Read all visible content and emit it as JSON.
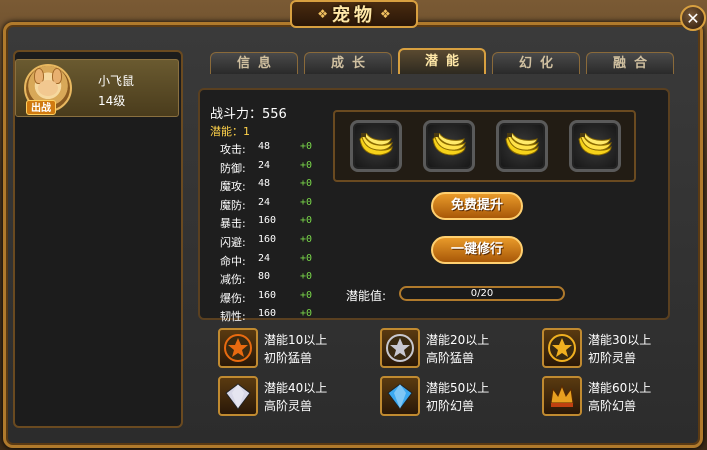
{
  "window": {
    "title": "宠物"
  },
  "pet": {
    "name": "小飞鼠",
    "level": "14级",
    "battle_tag": "出战"
  },
  "tabs": [
    {
      "label": "信息",
      "active": false
    },
    {
      "label": "成长",
      "active": false
    },
    {
      "label": "潜能",
      "active": true
    },
    {
      "label": "幻化",
      "active": false
    },
    {
      "label": "融合",
      "active": false
    }
  ],
  "stats": {
    "combat_power": "战斗力：556",
    "potential": "潜能：1",
    "rows": [
      {
        "name": "攻击:",
        "value": "48",
        "bonus": "+0"
      },
      {
        "name": "防御:",
        "value": "24",
        "bonus": "+0"
      },
      {
        "name": "魔攻:",
        "value": "48",
        "bonus": "+0"
      },
      {
        "name": "魔防:",
        "value": "24",
        "bonus": "+0"
      },
      {
        "name": "暴击:",
        "value": "160",
        "bonus": "+0"
      },
      {
        "name": "闪避:",
        "value": "160",
        "bonus": "+0"
      },
      {
        "name": "命中:",
        "value": "24",
        "bonus": "+0"
      },
      {
        "name": "减伤:",
        "value": "80",
        "bonus": "+0"
      },
      {
        "name": "爆伤:",
        "value": "160",
        "bonus": "+0"
      },
      {
        "name": "韧性:",
        "value": "160",
        "bonus": "+0"
      }
    ]
  },
  "slots": [
    {
      "icon": "banana-icon"
    },
    {
      "icon": "banana-icon"
    },
    {
      "icon": "banana-icon"
    },
    {
      "icon": "banana-icon"
    }
  ],
  "buttons": {
    "free_upgrade": "免费提升",
    "one_click_train": "一键修行"
  },
  "potential_bar": {
    "label": "潜能值:",
    "text": "0/20",
    "fraction": 0
  },
  "rewards": [
    {
      "line1": "潜能10以上",
      "line2": "初阶猛兽",
      "icon": "orange-star-badge-icon",
      "color": "#e86a10"
    },
    {
      "line1": "潜能20以上",
      "line2": "高阶猛兽",
      "icon": "silver-star-badge-icon",
      "color": "#c8c8d0"
    },
    {
      "line1": "潜能30以上",
      "line2": "初阶灵兽",
      "icon": "gold-star-badge-icon",
      "color": "#f0b020"
    },
    {
      "line1": "潜能40以上",
      "line2": "高阶灵兽",
      "icon": "silver-diamond-badge-icon",
      "color": "#d8d8e8"
    },
    {
      "line1": "潜能50以上",
      "line2": "初阶幻兽",
      "icon": "blue-diamond-badge-icon",
      "color": "#3aa8f0"
    },
    {
      "line1": "潜能60以上",
      "line2": "高阶幻兽",
      "icon": "crown-badge-icon",
      "color": "#e8a020"
    }
  ]
}
